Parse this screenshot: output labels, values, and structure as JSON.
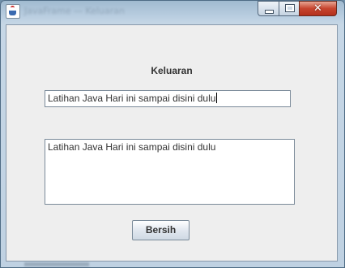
{
  "window": {
    "title": "JavaFrame — Keluaran"
  },
  "controls": {
    "minimize_icon": "minimize-icon",
    "maximize_icon": "maximize-icon",
    "close_icon": "close-icon",
    "close_glyph": "✕"
  },
  "main": {
    "heading": "Keluaran",
    "text_field_value": "Latihan Java Hari ini sampai disini dulu",
    "text_area_value": "Latihan Java Hari ini sampai disini dulu",
    "button_label": "Bersih"
  }
}
